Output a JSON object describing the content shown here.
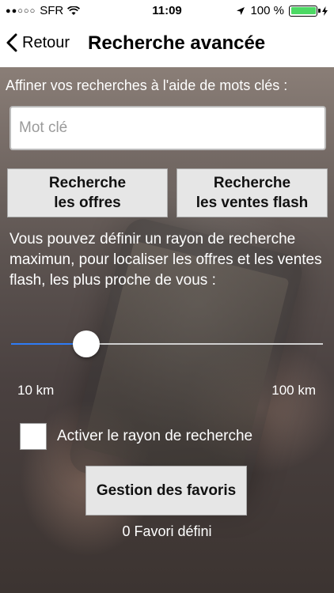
{
  "status_bar": {
    "carrier": "SFR",
    "time": "11:09",
    "battery_text": "100 %",
    "icons": [
      "signal-dots-icon",
      "wifi-icon",
      "location-arrow-icon",
      "battery-icon",
      "charging-bolt-icon"
    ]
  },
  "nav": {
    "back_label": "Retour",
    "title": "Recherche avancée"
  },
  "search": {
    "hint": "Affiner vos recherches à l'aide de mots clés :",
    "placeholder": "Mot clé",
    "value": ""
  },
  "buttons": {
    "offres_line1": "Recherche",
    "offres_line2": "les offres",
    "ventes_line1": "Recherche",
    "ventes_line2": "les ventes flash"
  },
  "radius": {
    "description": "Vous pouvez définir un rayon de recherche maximun, pour localiser les offres et les ventes flash, les plus proche de vous :",
    "min_label": "10 km",
    "max_label": "100 km",
    "slider_fraction": 0.24,
    "accent_color": "#2f7cf6",
    "checkbox_label": "Activer le rayon de recherche",
    "checkbox_checked": false
  },
  "favorites": {
    "button_label": "Gestion des favoris",
    "count_text": "0 Favori défini"
  }
}
